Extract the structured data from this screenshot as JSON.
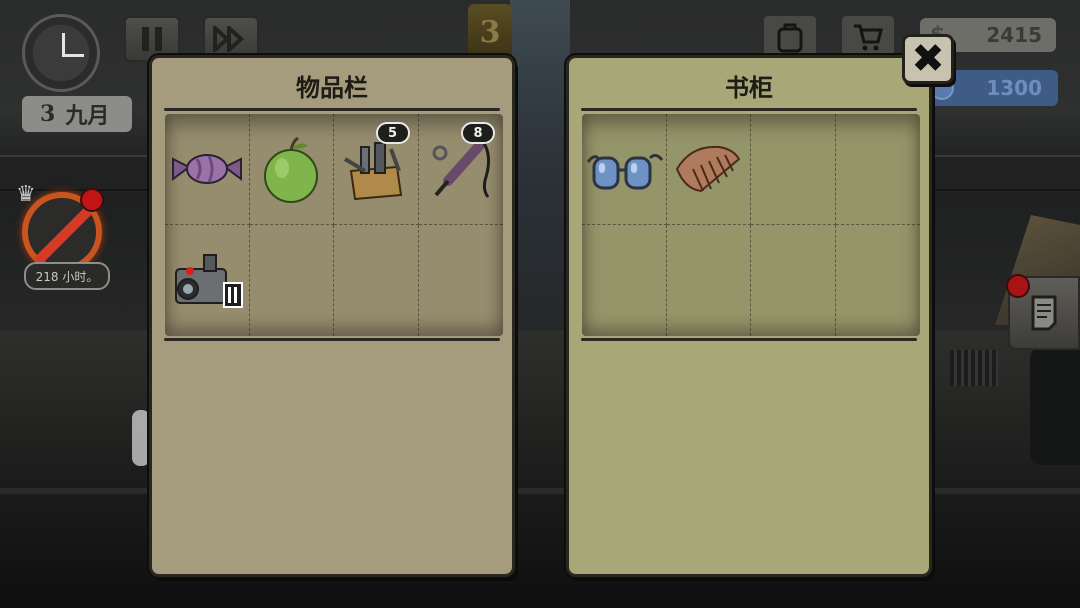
{
  "hud": {
    "date_day": "3",
    "date_month": "九月",
    "level": "3",
    "money": "2415",
    "money_symbol": "$",
    "gems": "1300",
    "status_timer": "218 小时。"
  },
  "inventory_panel": {
    "title": "物品栏",
    "slots": [
      {
        "item": "candy-icon",
        "count": null
      },
      {
        "item": "green-apple-icon",
        "count": null
      },
      {
        "item": "toolbox-icon",
        "count": "5"
      },
      {
        "item": "soldering-iron-icon",
        "count": "8"
      },
      {
        "item": "camera-icon",
        "count": null
      },
      {
        "item": null,
        "count": null
      },
      {
        "item": null,
        "count": null
      },
      {
        "item": null,
        "count": null
      }
    ]
  },
  "bookcase_panel": {
    "title": "书柜",
    "slots": [
      {
        "item": "goggles-icon",
        "count": null
      },
      {
        "item": "comb-icon",
        "count": null
      },
      {
        "item": null,
        "count": null
      },
      {
        "item": null,
        "count": null
      },
      {
        "item": null,
        "count": null
      },
      {
        "item": null,
        "count": null
      },
      {
        "item": null,
        "count": null
      },
      {
        "item": null,
        "count": null
      }
    ]
  },
  "close_button": {
    "icon": "close-icon",
    "label": "✖"
  },
  "colors": {
    "inventory_bg": "#a59b7d",
    "bookcase_bg": "#a7a778",
    "alert_red": "#c21414",
    "gem_blue": "#3f5c86"
  }
}
